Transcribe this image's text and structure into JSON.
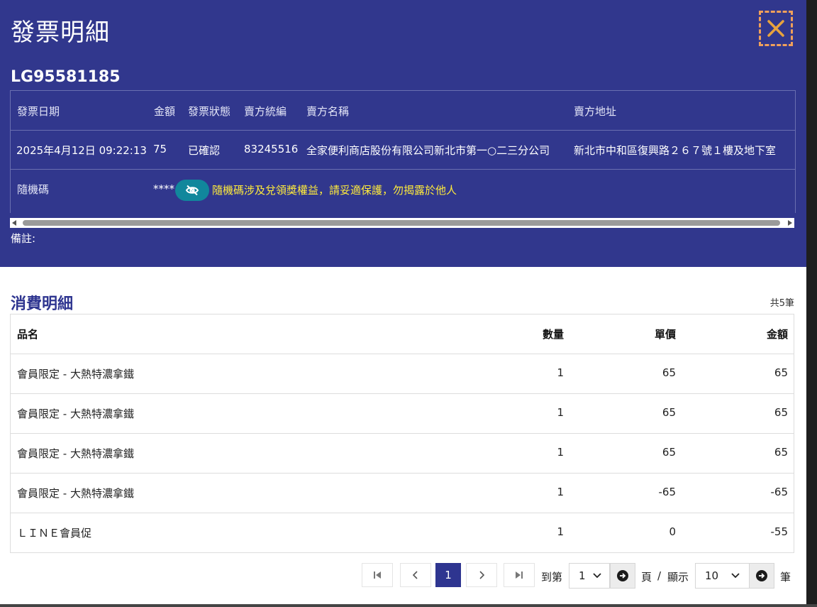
{
  "modal": {
    "title": "發票明細",
    "invoice_number": "LG95581185",
    "info_headers": [
      "發票日期",
      "金額",
      "發票狀態",
      "賣方統編",
      "賣方名稱",
      "賣方地址"
    ],
    "info_values": [
      "2025年4月12日 09:22:13",
      "75",
      "已確認",
      "83245516",
      "全家便利商店股份有限公司新北市第一○二三分公司",
      "新北市中和區復興路２６７號１樓及地下室"
    ],
    "random_code_label": "隨機碼",
    "random_code_masked": "****",
    "random_code_warning": "隨機碼涉及兌領獎權益，請妥適保護，勿揭露於他人",
    "remark_label": "備註:"
  },
  "details": {
    "title": "消費明細",
    "total_count": "共5筆",
    "headers": {
      "name": "品名",
      "qty": "數量",
      "unit": "單價",
      "amount": "金額"
    },
    "rows": [
      {
        "name": "會員限定 - 大熱特濃拿鐵",
        "qty": "1",
        "unit": "65",
        "amount": "65"
      },
      {
        "name": "會員限定 - 大熱特濃拿鐵",
        "qty": "1",
        "unit": "65",
        "amount": "65"
      },
      {
        "name": "會員限定 - 大熱特濃拿鐵",
        "qty": "1",
        "unit": "65",
        "amount": "65"
      },
      {
        "name": "會員限定 - 大熱特濃拿鐵",
        "qty": "1",
        "unit": "-65",
        "amount": "-65"
      },
      {
        "name": "ＬＩＮＥ會員促",
        "qty": "1",
        "unit": "0",
        "amount": "-55"
      }
    ]
  },
  "pagination": {
    "current_page": "1",
    "goto_label": "到第",
    "page_select": "1",
    "page_unit": "頁",
    "separator": "/",
    "show_label": "顯示",
    "page_size": "10",
    "items_unit": "筆"
  },
  "colors": {
    "header_bg": "#31378d",
    "accent": "#2e3590",
    "warning": "#ffeb3b",
    "reveal_button": "#11879c",
    "close_icon": "#e8a33d"
  }
}
